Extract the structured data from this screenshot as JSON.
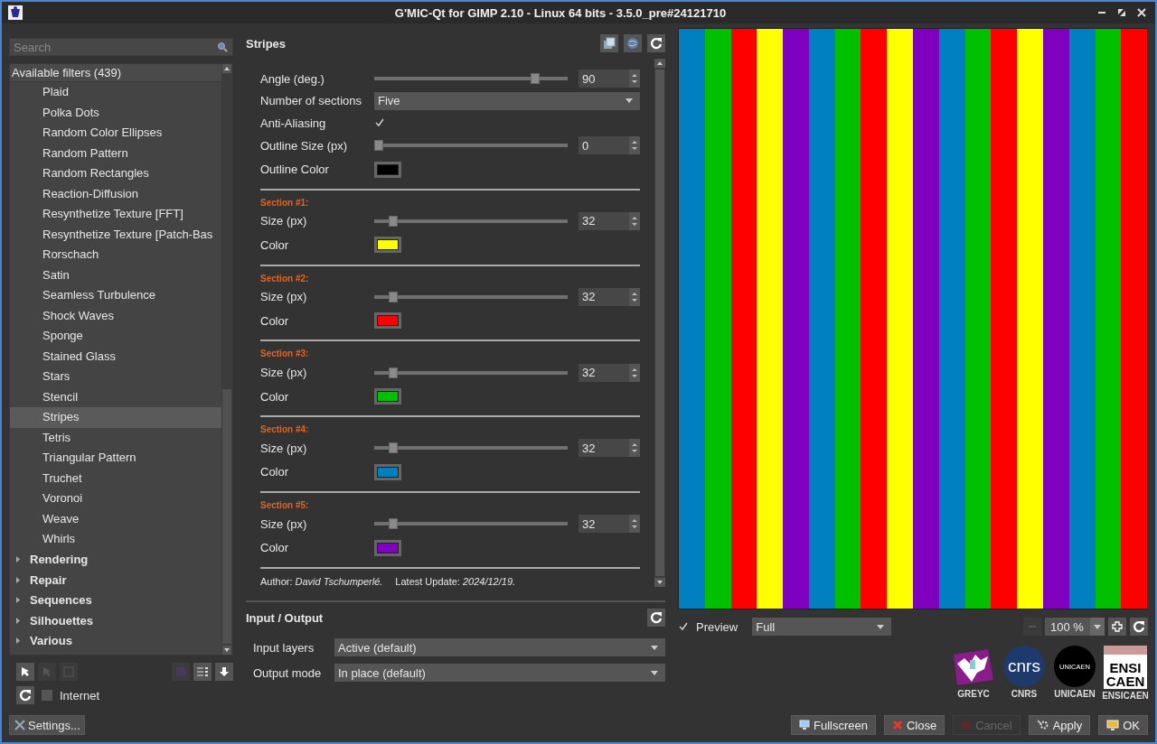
{
  "window": {
    "title": "G'MIC-Qt for GIMP 2.10 - Linux 64 bits - 3.5.0_pre#24121710"
  },
  "filters": {
    "search": {
      "placeholder": "Search"
    },
    "header": "Available filters (439)",
    "items": [
      {
        "label": "Plaid",
        "selected": false
      },
      {
        "label": "Polka Dots",
        "selected": false
      },
      {
        "label": "Random Color Ellipses",
        "selected": false
      },
      {
        "label": "Random Pattern",
        "selected": false
      },
      {
        "label": "Random Rectangles",
        "selected": false
      },
      {
        "label": "Reaction-Diffusion",
        "selected": false
      },
      {
        "label": "Resynthetize Texture [FFT]",
        "selected": false
      },
      {
        "label": "Resynthetize Texture [Patch-Bas",
        "selected": false
      },
      {
        "label": "Rorschach",
        "selected": false
      },
      {
        "label": "Satin",
        "selected": false
      },
      {
        "label": "Seamless Turbulence",
        "selected": false
      },
      {
        "label": "Shock Waves",
        "selected": false
      },
      {
        "label": "Sponge",
        "selected": false
      },
      {
        "label": "Stained Glass",
        "selected": false
      },
      {
        "label": "Stars",
        "selected": false
      },
      {
        "label": "Stencil",
        "selected": false
      },
      {
        "label": "Stripes",
        "selected": true
      },
      {
        "label": "Tetris",
        "selected": false
      },
      {
        "label": "Triangular Pattern",
        "selected": false
      },
      {
        "label": "Truchet",
        "selected": false
      },
      {
        "label": "Voronoi",
        "selected": false
      },
      {
        "label": "Weave",
        "selected": false
      },
      {
        "label": "Whirls",
        "selected": false
      }
    ],
    "categories": [
      {
        "label": "Rendering",
        "expanded": false
      },
      {
        "label": "Repair",
        "expanded": false
      },
      {
        "label": "Sequences",
        "expanded": false
      },
      {
        "label": "Silhouettes",
        "expanded": false
      },
      {
        "label": "Various",
        "expanded": false
      }
    ],
    "internet": {
      "label": "Internet",
      "checked": false
    },
    "settings_button": "Settings..."
  },
  "filter": {
    "title": "Stripes",
    "params": [
      {
        "kind": "slider",
        "label": "Angle (deg.)",
        "value": "90",
        "level": 0.85
      },
      {
        "kind": "select",
        "label": "Number of sections",
        "value": "Five"
      },
      {
        "kind": "checkbox",
        "label": "Anti-Aliasing",
        "checked": true
      },
      {
        "kind": "slider",
        "label": "Outline Size (px)",
        "value": "0",
        "level": 0
      },
      {
        "kind": "color",
        "label": "Outline Color",
        "color": "#000000"
      },
      {
        "kind": "separator"
      },
      {
        "kind": "section",
        "label": "Section #1:"
      },
      {
        "kind": "slider",
        "label": "Size (px)",
        "value": "32",
        "level": 0.08
      },
      {
        "kind": "color",
        "label": "Color",
        "color": "#ffff00"
      },
      {
        "kind": "separator"
      },
      {
        "kind": "section",
        "label": "Section #2:"
      },
      {
        "kind": "slider",
        "label": "Size (px)",
        "value": "32",
        "level": 0.08
      },
      {
        "kind": "color",
        "label": "Color",
        "color": "#ff0000"
      },
      {
        "kind": "separator"
      },
      {
        "kind": "section",
        "label": "Section #3:"
      },
      {
        "kind": "slider",
        "label": "Size (px)",
        "value": "32",
        "level": 0.08
      },
      {
        "kind": "color",
        "label": "Color",
        "color": "#00c000"
      },
      {
        "kind": "separator"
      },
      {
        "kind": "section",
        "label": "Section #4:"
      },
      {
        "kind": "slider",
        "label": "Size (px)",
        "value": "32",
        "level": 0.08
      },
      {
        "kind": "color",
        "label": "Color",
        "color": "#0080c0"
      },
      {
        "kind": "separator"
      },
      {
        "kind": "section",
        "label": "Section #5:"
      },
      {
        "kind": "slider",
        "label": "Size (px)",
        "value": "32",
        "level": 0.08
      },
      {
        "kind": "color",
        "label": "Color",
        "color": "#8000c0"
      },
      {
        "kind": "separator"
      }
    ],
    "author": "Author: *David Tschumperlé.*",
    "update": "Latest Update: *2024/12/19.*"
  },
  "io": {
    "title": "Input / Output",
    "input_layers": {
      "label": "Input layers",
      "value": "Active (default)"
    },
    "output_mode": {
      "label": "Output mode",
      "value": "In place (default)"
    }
  },
  "preview": {
    "checkbox": {
      "label": "Preview",
      "checked": true
    },
    "mode": "Full",
    "zoom": "100 %"
  },
  "logos": [
    {
      "kind": "greyc",
      "caption": "GREYC"
    },
    {
      "kind": "cnrs",
      "text": "cnrs",
      "caption": "CNRS"
    },
    {
      "kind": "unicaen",
      "text": "UNICAEN",
      "caption": "UNICAEN"
    },
    {
      "kind": "ensicaen",
      "text": "ENSI",
      "text2": "CAEN",
      "caption": "ENSICAEN"
    }
  ],
  "buttons": [
    {
      "kind": "fullscreen",
      "label": "Fullscreen",
      "disabled": false
    },
    {
      "kind": "close",
      "label": "Close",
      "disabled": false
    },
    {
      "kind": "cancel",
      "label": "Cancel",
      "disabled": true
    },
    {
      "kind": "apply",
      "label": "Apply",
      "disabled": false
    },
    {
      "kind": "ok",
      "label": "OK",
      "disabled": false
    }
  ]
}
